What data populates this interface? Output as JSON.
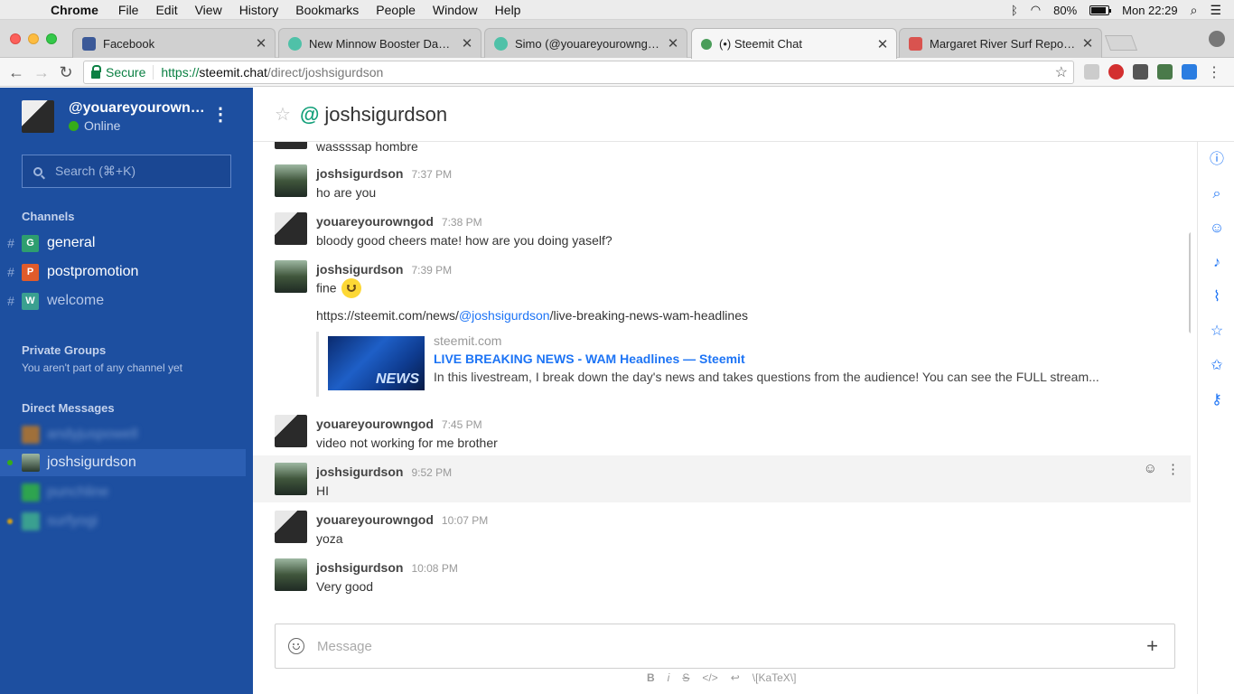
{
  "menubar": {
    "app": "Chrome",
    "items": [
      "File",
      "Edit",
      "View",
      "History",
      "Bookmarks",
      "People",
      "Window",
      "Help"
    ],
    "battery": "80%",
    "clock": "Mon 22:29"
  },
  "tabs": [
    {
      "label": "Facebook",
      "color": "#3b5998"
    },
    {
      "label": "New Minnow Booster Day Rule",
      "color": "#4fc1a8"
    },
    {
      "label": "Simo (@youareyourowngod) —",
      "color": "#4fc1a8"
    },
    {
      "label": "(•) Steemit Chat",
      "color": "#4a9d5a"
    },
    {
      "label": "Margaret River Surf Report, Su",
      "color": "#d9534f"
    }
  ],
  "address": {
    "secure_label": "Secure",
    "scheme": "https://",
    "host": "steemit.chat",
    "path": "/direct/joshsigurdson"
  },
  "sidebar": {
    "username": "@youareyourowngod",
    "status": "Online",
    "search_placeholder": "Search (⌘+K)",
    "channels_title": "Channels",
    "channels": [
      {
        "letter": "G",
        "name": "general",
        "color": "#2e9e6f"
      },
      {
        "letter": "P",
        "name": "postpromotion",
        "color": "#e05b2b"
      },
      {
        "letter": "W",
        "name": "welcome",
        "color": "#3aa090"
      }
    ],
    "private_title": "Private Groups",
    "private_empty": "You aren't part of any channel yet",
    "dm_title": "Direct Messages",
    "dms": [
      {
        "name": "andyjuspowell",
        "blurred": true
      },
      {
        "name": "joshsigurdson",
        "blurred": false
      },
      {
        "name": "punchline",
        "blurred": true
      },
      {
        "name": "surfyogi",
        "blurred": true
      }
    ]
  },
  "room": {
    "name": "joshsigurdson"
  },
  "messages": [
    {
      "body": "wassssap hombre"
    },
    {
      "author": "joshsigurdson",
      "time": "7:37 PM",
      "body": "ho are you"
    },
    {
      "author": "youareyourowngod",
      "time": "7:38 PM",
      "body": "bloody good cheers mate! how are you doing yaself?"
    },
    {
      "author": "joshsigurdson",
      "time": "7:39 PM",
      "body": "fine",
      "link_prefix": "https://steemit.com/news/",
      "link_mention": "@joshsigurdson",
      "link_suffix": "/live-breaking-news-wam-headlines",
      "preview": {
        "site": "steemit.com",
        "title": "LIVE BREAKING NEWS - WAM Headlines — Steemit",
        "description": "In this livestream, I break down the day's news and takes questions from the audience! You can see the FULL stream...",
        "image_text": "NEWS"
      }
    },
    {
      "author": "youareyourowngod",
      "time": "7:45 PM",
      "body": "video not working for me brother"
    },
    {
      "author": "joshsigurdson",
      "time": "9:52 PM",
      "body": "HI"
    },
    {
      "author": "youareyourowngod",
      "time": "10:07 PM",
      "body": "yoza"
    },
    {
      "author": "joshsigurdson",
      "time": "10:08 PM",
      "body": "Very good"
    }
  ],
  "composer": {
    "placeholder": "Message",
    "format_bold": "B",
    "format_italic": "i",
    "format_strike": "S",
    "format_code": "</>",
    "format_enter": "↩",
    "format_katex": "\\[KaTeX\\]"
  }
}
